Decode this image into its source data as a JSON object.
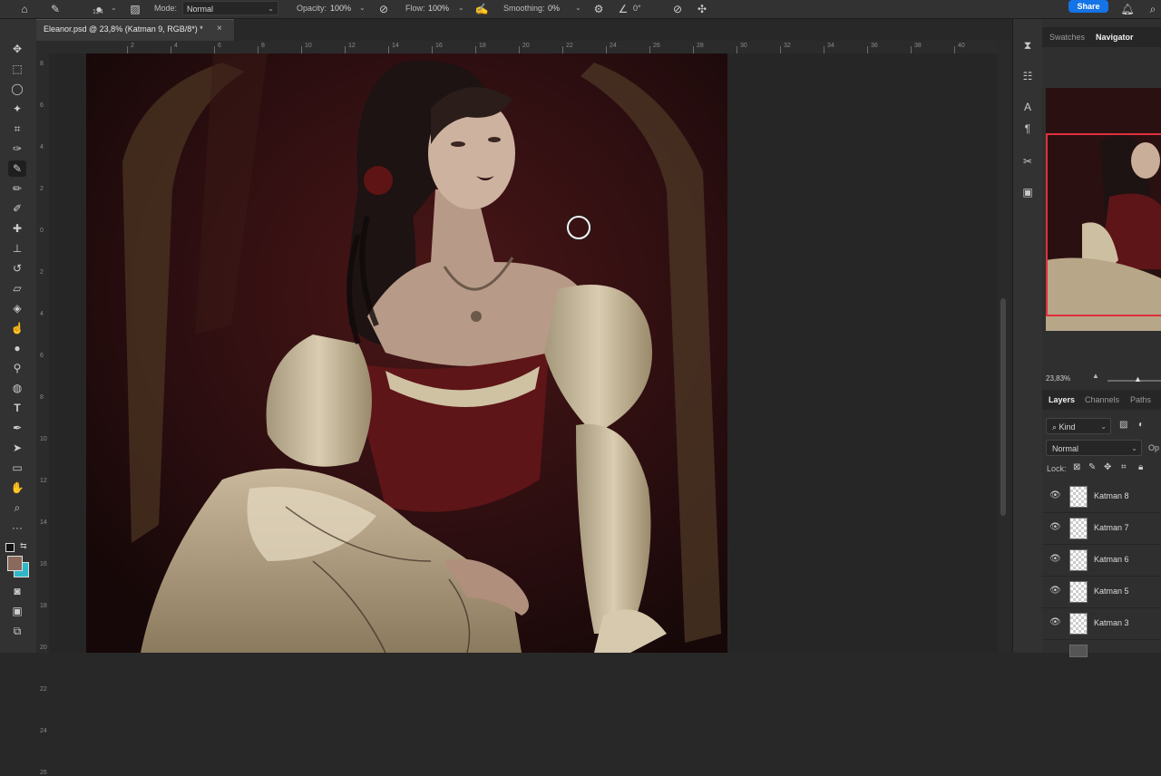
{
  "options_bar": {
    "home_icon": "home-icon",
    "brush_size": "124",
    "mode_label": "Mode:",
    "mode_value": "Normal",
    "opacity_label": "Opacity:",
    "opacity_value": "100%",
    "flow_label": "Flow:",
    "flow_value": "100%",
    "smoothing_label": "Smoothing:",
    "smoothing_value": "0%",
    "angle_value": "0°",
    "share_label": "Share"
  },
  "document_tab": {
    "title": "Eleanor.psd @ 23,8% (Katman 9, RGB/8*) *",
    "close": "×"
  },
  "ruler": {
    "h_ticks": [
      "2",
      "4",
      "6",
      "8",
      "10",
      "12",
      "14",
      "16",
      "18",
      "20",
      "22",
      "24",
      "26",
      "28",
      "30",
      "32",
      "34",
      "36",
      "38",
      "40"
    ],
    "v_ticks": [
      "8",
      "6",
      "4",
      "2",
      "0",
      "2",
      "4",
      "6",
      "8",
      "10",
      "12",
      "14",
      "16",
      "18",
      "20",
      "22",
      "24",
      "26"
    ]
  },
  "panel": {
    "tabs_top": [
      "Swatches",
      "Navigator"
    ],
    "zoom_value": "23,83%",
    "tabs_layers": [
      "Layers",
      "Channels",
      "Paths"
    ],
    "kind_label": "Kind",
    "blend_value": "Normal",
    "opacity_short": "Op",
    "lock_label": "Lock:",
    "layers": [
      "Katman 8",
      "Katman 7",
      "Katman 6",
      "Katman 5",
      "Katman 3"
    ]
  },
  "colors": {
    "foreground": "#8b6a5e",
    "background": "#2fb7c8",
    "accent": "#1473e6",
    "navigator_frame": "#e0303c"
  }
}
